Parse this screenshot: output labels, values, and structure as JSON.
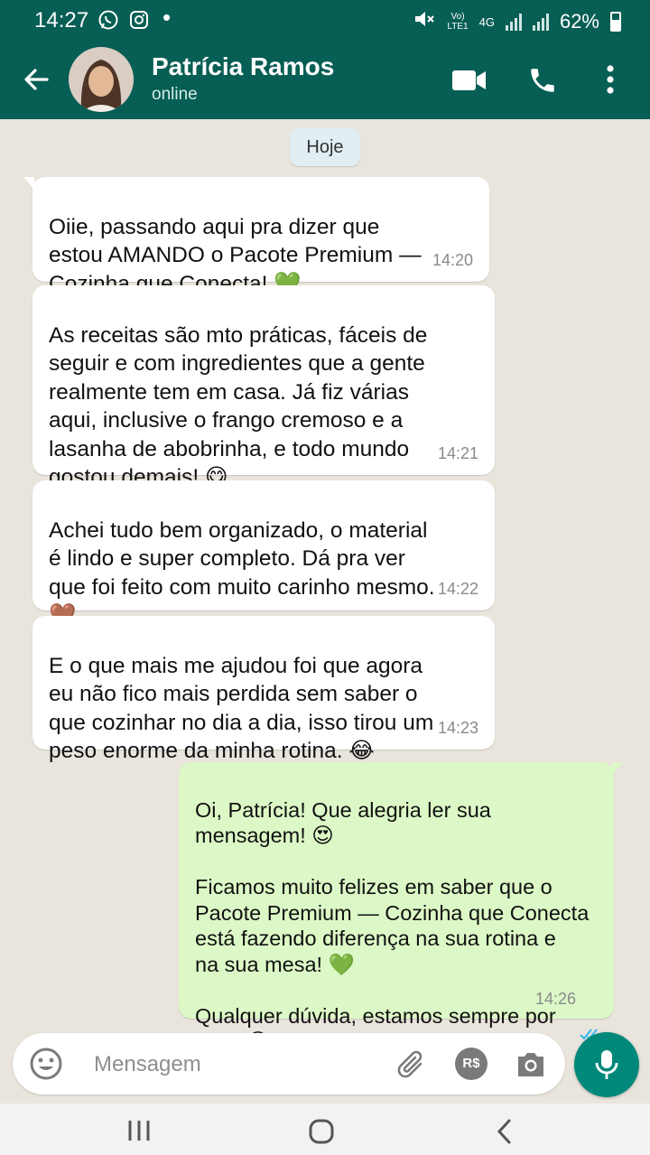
{
  "status_bar": {
    "time": "14:27",
    "net_top": "Vo)",
    "net_bottom": "LTE1",
    "network_type": "4G",
    "battery": "62%",
    "icons": [
      "whatsapp-icon",
      "instagram-icon",
      "dot-icon",
      "mute-icon",
      "signal-icon",
      "battery-icon"
    ]
  },
  "header": {
    "contact_name": "Patrícia Ramos",
    "status": "online",
    "icons": [
      "back-arrow-icon",
      "video-call-icon",
      "phone-icon",
      "more-vert-icon"
    ]
  },
  "date_chip": "Hoje",
  "messages": [
    {
      "direction": "in",
      "text": "Oiie, passando aqui pra dizer que\nestou AMANDO o Pacote Premium —\nCozinha que Conecta! 💚",
      "time": "14:20"
    },
    {
      "direction": "in",
      "text": "As receitas são mto práticas, fáceis de\nseguir e com ingredientes que a gente\nrealmente tem em casa. Já fiz várias\naqui, inclusive o frango cremoso e a\nlasanha de abobrinha, e todo mundo\ngostou demais! 😋",
      "time": "14:21"
    },
    {
      "direction": "in",
      "text": "Achei tudo bem organizado, o material\né lindo e super completo. Dá pra ver\nque foi feito com muito carinho mesmo.\n🤎",
      "time": "14:22"
    },
    {
      "direction": "in",
      "text": "E o que mais me ajudou foi que agora\neu não fico mais perdida sem saber o\nque cozinhar no dia a dia, isso tirou um\npeso enorme da minha rotina. 😂",
      "time": "14:23"
    },
    {
      "direction": "out",
      "text": "Oi, Patrícia! Que alegria ler sua\nmensagem! 😍\n\nFicamos muito felizes em saber que o\nPacote Premium — Cozinha que Conecta\nestá fazendo diferença na sua rotina e\nna sua mesa! 💚\n\nQualquer dúvida, estamos sempre por\naqui! 😊",
      "time": "14:26",
      "read": true
    }
  ],
  "input": {
    "placeholder": "Mensagem",
    "icons": [
      "emoji-icon",
      "attach-icon",
      "payment-icon",
      "camera-icon",
      "mic-icon"
    ],
    "payment_label": "R$"
  },
  "nav": {
    "icons": [
      "recent-apps-icon",
      "home-icon",
      "back-icon"
    ]
  },
  "colors": {
    "header": "#075e54",
    "outgoing_bubble": "#dcf8c6",
    "incoming_bubble": "#ffffff",
    "accent": "#00897b",
    "read_ticks": "#34b7f1"
  }
}
